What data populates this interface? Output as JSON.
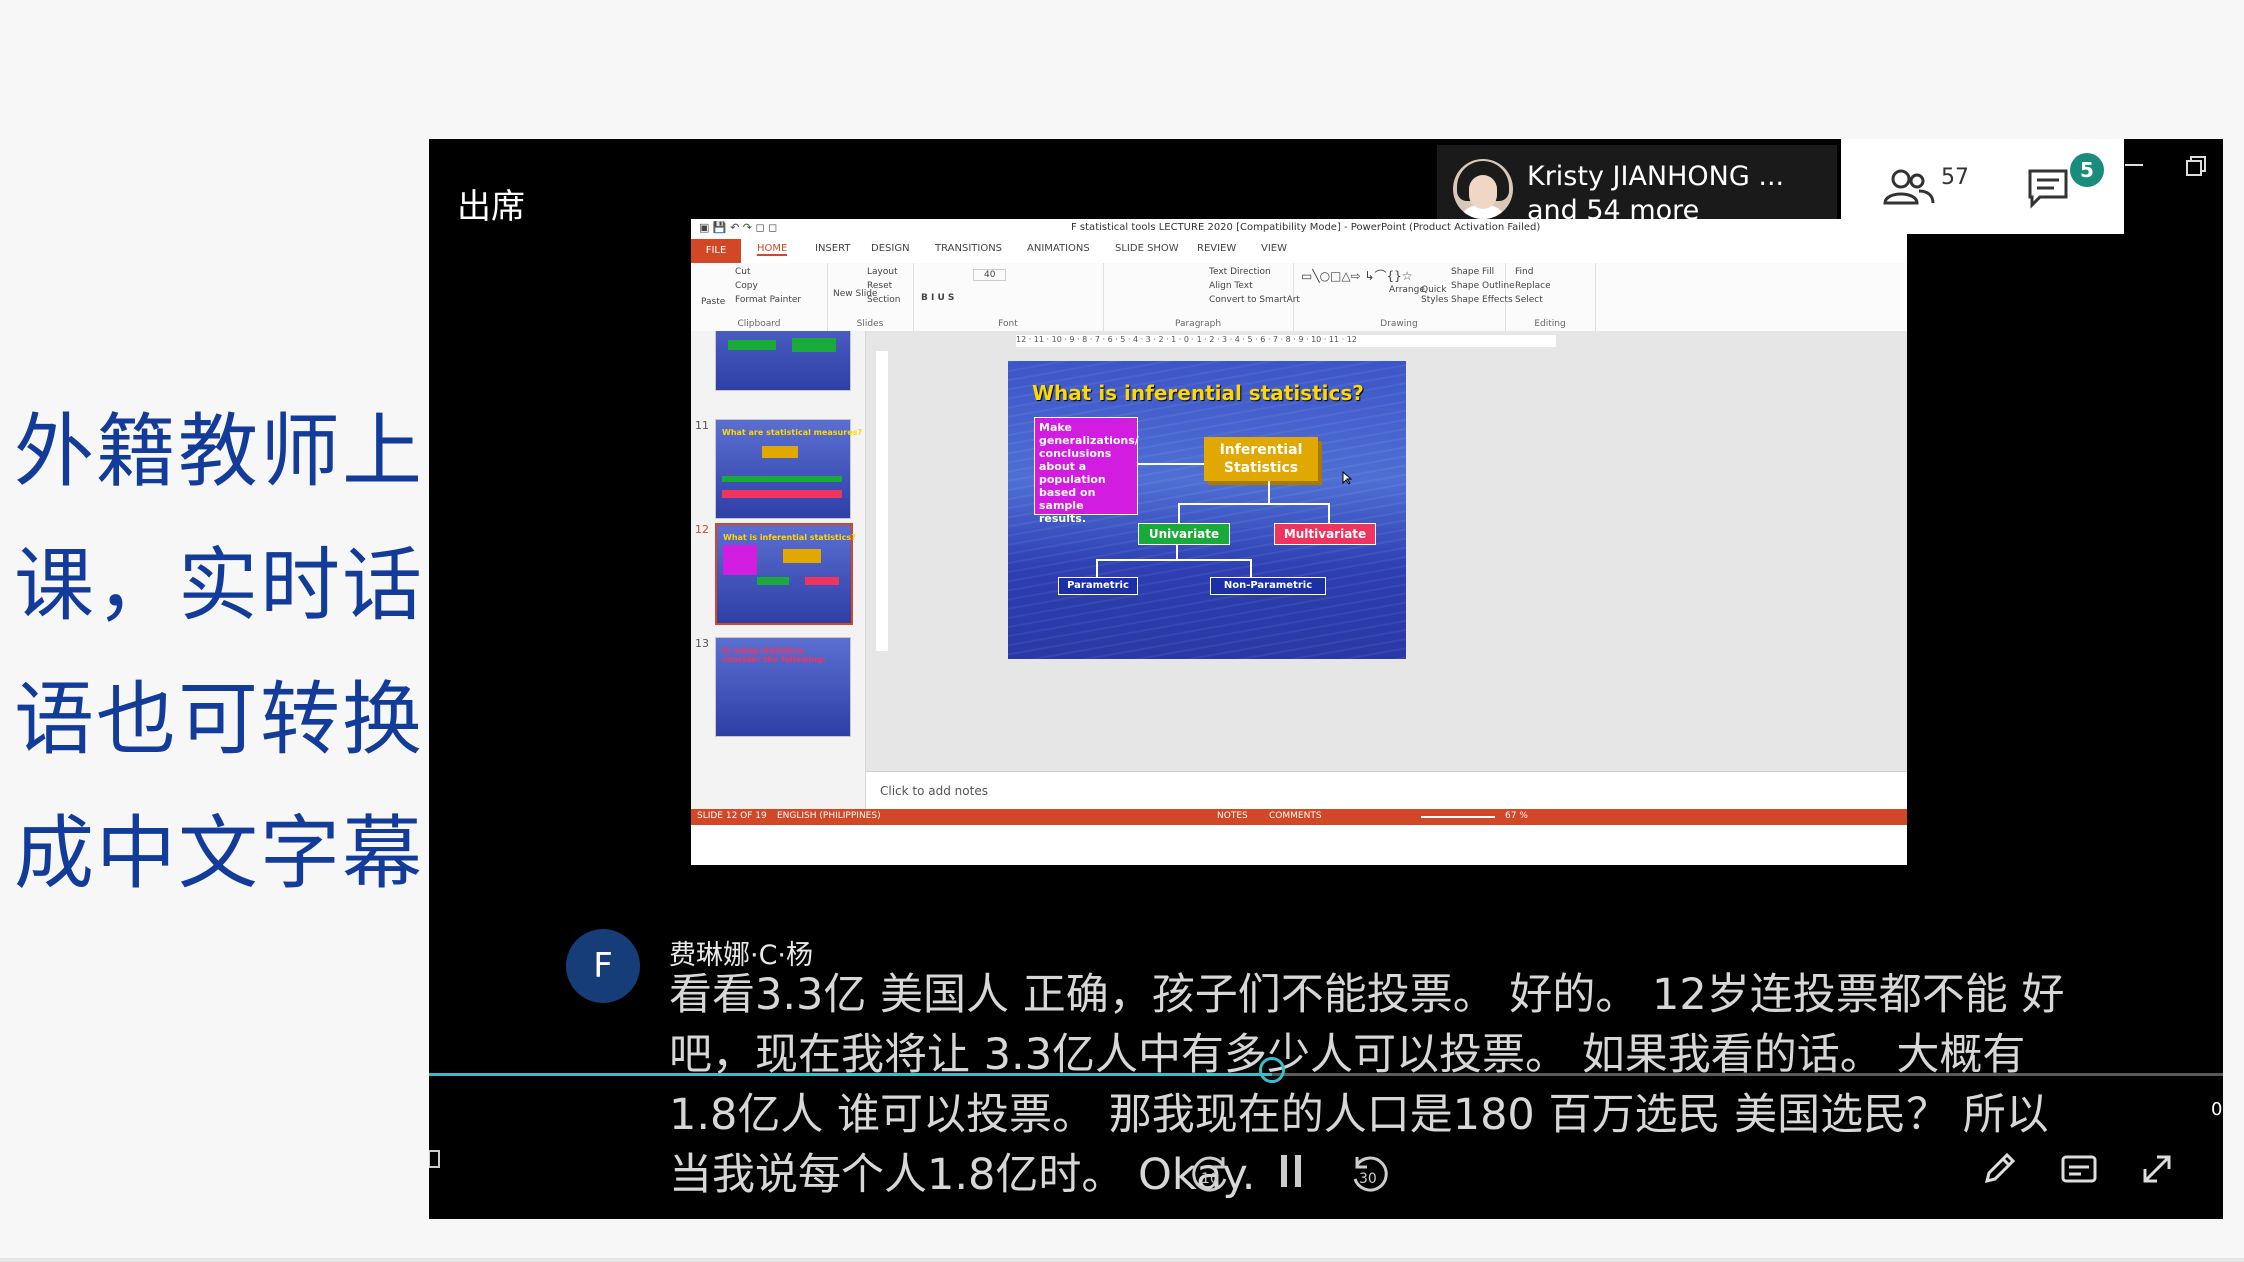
{
  "side_caption": {
    "lines": [
      "外籍教师上",
      "课，实时话",
      "语也可转换",
      "成中文字幕"
    ]
  },
  "meeting": {
    "title": "出席",
    "participant": {
      "name": "Kristy JIANHONG ...",
      "more": "and 54 more"
    },
    "people_count": "57",
    "chat_badge": "5"
  },
  "ppt": {
    "window_title": "F statistical tools LECTURE 2020 [Compatibility Mode] - PowerPoint (Product Activation Failed)",
    "tabs": [
      "FILE",
      "HOME",
      "INSERT",
      "DESIGN",
      "TRANSITIONS",
      "ANIMATIONS",
      "SLIDE SHOW",
      "REVIEW",
      "VIEW"
    ],
    "ribbon": {
      "clipboard": {
        "paste": "Paste",
        "cut": "Cut",
        "copy": "Copy",
        "format_painter": "Format Painter",
        "label": "Clipboard"
      },
      "slides": {
        "new_slide": "New Slide",
        "layout": "Layout",
        "reset": "Reset",
        "section": "Section",
        "label": "Slides"
      },
      "font": {
        "size": "40",
        "label": "Font"
      },
      "paragraph": {
        "text_direction": "Text Direction",
        "align_text": "Align Text",
        "convert": "Convert to SmartArt",
        "label": "Paragraph"
      },
      "drawing": {
        "arrange": "Arrange",
        "quick_styles": "Quick Styles",
        "shape_fill": "Shape Fill",
        "shape_outline": "Shape Outline",
        "shape_effects": "Shape Effects",
        "label": "Drawing"
      },
      "editing": {
        "find": "Find",
        "replace": "Replace",
        "select": "Select",
        "label": "Editing"
      }
    },
    "thumbnails": [
      {
        "num": "",
        "title": ""
      },
      {
        "num": "11",
        "title": "What are statistical measures?"
      },
      {
        "num": "12",
        "title": "What is inferential statistics?"
      },
      {
        "num": "13",
        "title": "In using statistics, consider the following:"
      }
    ],
    "slide": {
      "title": "What is inferential statistics?",
      "definition": "Make generalizations/ conclusions about a population based on sample results.",
      "inferential": "Inferential Statistics",
      "univariate": "Univariate",
      "multivariate": "Multivariate",
      "parametric": "Parametric",
      "non_parametric": "Non-Parametric"
    },
    "ruler_text": "12 · 11 · 10 · 9 · 8 · 7 · 6 · 5 · 4 · 3 · 2 · 1 · 0 · 1 · 2 · 3 · 4 · 5 · 6 · 7 · 8 · 9 · 10 · 11 · 12",
    "notes_placeholder": "Click to add notes",
    "status": {
      "slide": "SLIDE 12 OF 19",
      "language": "ENGLISH (PHILIPPINES)",
      "notes": "NOTES",
      "comments": "COMMENTS",
      "zoom": "67 %"
    },
    "accent": "#d24726"
  },
  "caption": {
    "avatar_letter": "F",
    "speaker": "费琳娜·C·杨",
    "text": "看看3.3亿 美国人 正确，孩子们不能投票。 好的。 12岁连投票都不能 好吧，现在我将让 3.3亿人中有多少人可以投票。 如果我看的话。 大概有1.8亿人 谁可以投票。 那我现在的人口是180 百万选民 美国选民？ 所以当我说每个人1.8亿时。 Okay."
  },
  "player": {
    "progress_fraction": 0.47,
    "rewind_label": "10",
    "forward_label": "30",
    "time": "0",
    "accent": "#33c0c8"
  }
}
